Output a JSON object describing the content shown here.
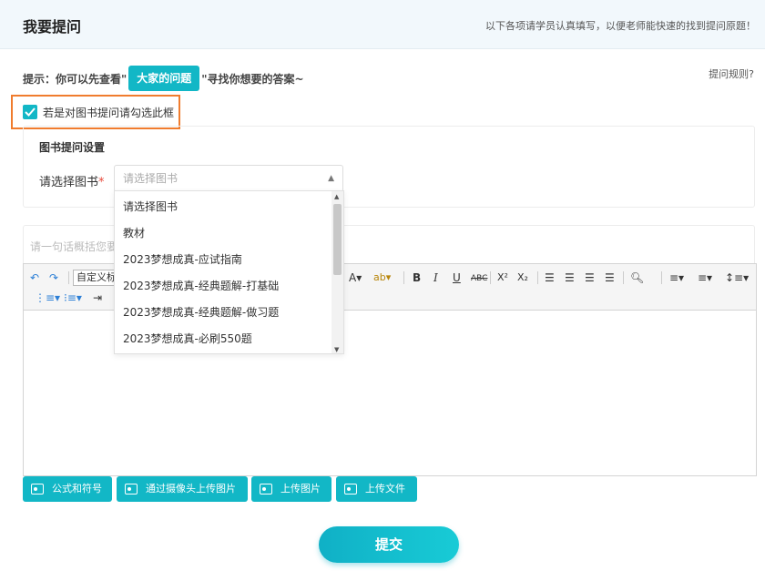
{
  "header": {
    "title": "我要提问",
    "subtitle": "以下各项请学员认真填写，以便老师能快速的找到提问原题！"
  },
  "tip": {
    "prefix": "提示：你可以先查看\"",
    "button": "大家的问题",
    "suffix": "\"寻找你想要的答案~"
  },
  "rules_link": "提问规则?",
  "book_checkbox": {
    "label": "若是对图书提问请勾选此框",
    "checked": true
  },
  "book_settings": {
    "title": "图书提问设置",
    "field_label": "请选择图书",
    "required_mark": "*",
    "select_placeholder": "请选择图书",
    "options": [
      "请选择图书",
      "教材",
      "2023梦想成真-应试指南",
      "2023梦想成真-经典题解-打基础",
      "2023梦想成真-经典题解-做习题",
      "2023梦想成真-必刷550题"
    ]
  },
  "summary_placeholder": "请一句话概括您要",
  "editor": {
    "font_select": "自定义标"
  },
  "actions": [
    "公式和符号",
    "通过摄像头上传图片",
    "上传图片",
    "上传文件"
  ],
  "submit_label": "提交",
  "colors": {
    "accent": "#12b7c6",
    "highlight_border": "#f07c2e",
    "required": "#e84a3c"
  }
}
